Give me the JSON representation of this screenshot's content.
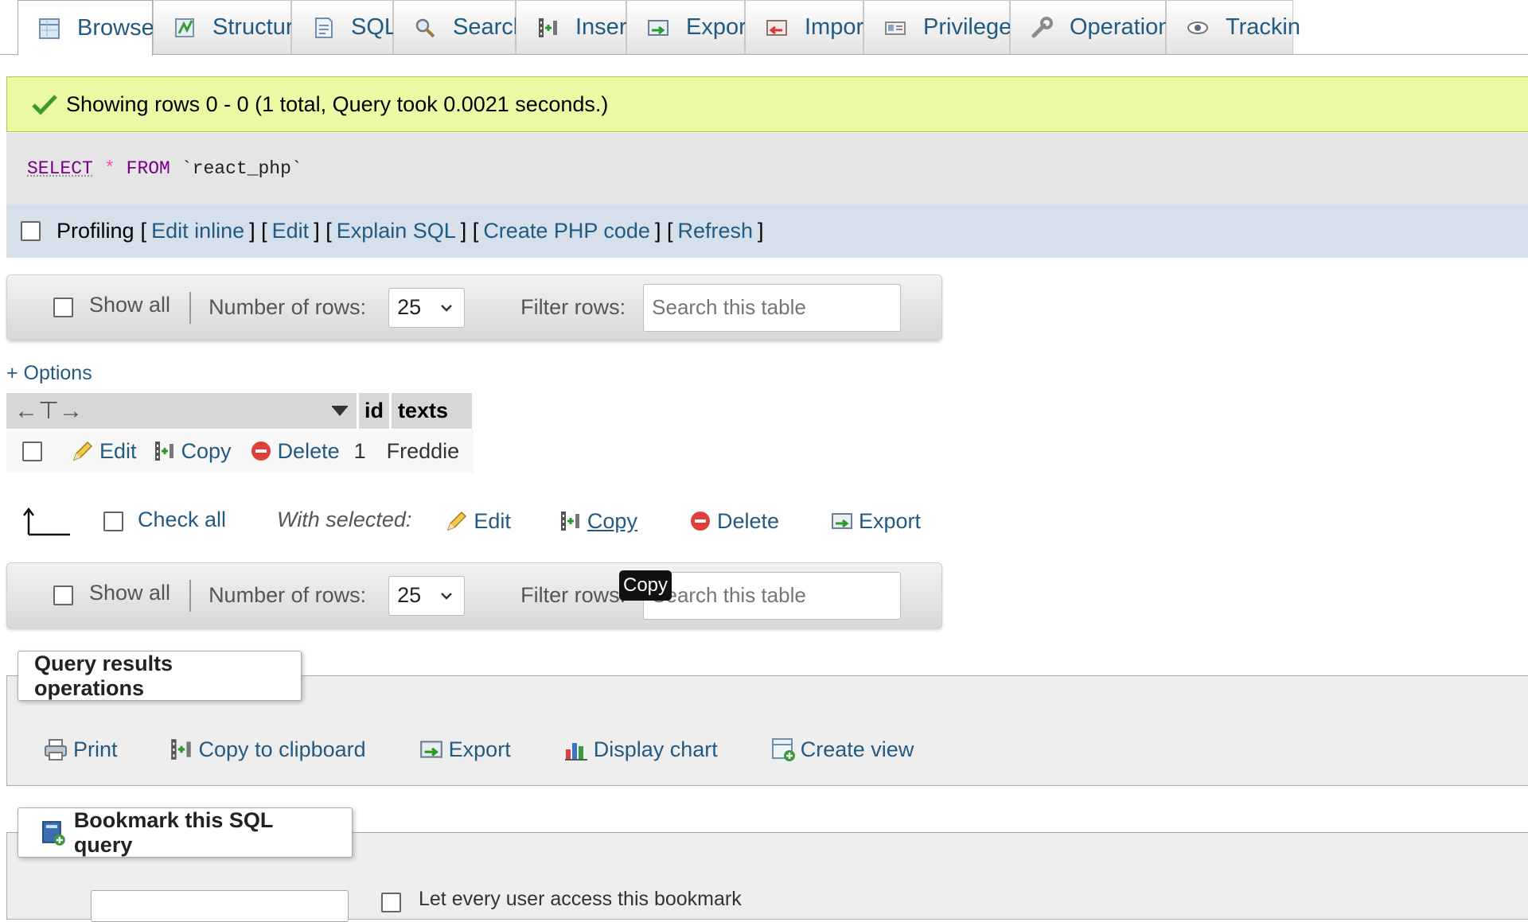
{
  "tabs": [
    {
      "label": "Browse",
      "icon": "browse-icon",
      "active": true
    },
    {
      "label": "Structure",
      "icon": "structure-icon"
    },
    {
      "label": "SQL",
      "icon": "sql-icon"
    },
    {
      "label": "Search",
      "icon": "search-icon"
    },
    {
      "label": "Insert",
      "icon": "insert-icon"
    },
    {
      "label": "Export",
      "icon": "export-icon"
    },
    {
      "label": "Import",
      "icon": "import-icon"
    },
    {
      "label": "Privileges",
      "icon": "privileges-icon"
    },
    {
      "label": "Operations",
      "icon": "wrench-icon"
    },
    {
      "label": "Trackin",
      "icon": "eye-icon"
    }
  ],
  "message": {
    "text": "Showing rows 0 - 0 (1 total, Query took 0.0021 seconds.)",
    "color": "#ebf8a4"
  },
  "sql": {
    "select": "SELECT",
    "star": "*",
    "from": "FROM",
    "table": "`react_php`"
  },
  "profiling": {
    "label": "Profiling",
    "links": [
      "Edit inline",
      "Edit",
      "Explain SQL",
      "Create PHP code",
      "Refresh"
    ]
  },
  "nav": {
    "show_all": "Show all",
    "rows_label": "Number of rows:",
    "rows_value": "25",
    "filter_label": "Filter rows:",
    "filter_placeholder": "Search this table"
  },
  "options_link": "+ Options",
  "table": {
    "columns": [
      "id",
      "texts"
    ],
    "rows": [
      {
        "id": "1",
        "texts": "Freddie"
      }
    ],
    "row_actions": [
      "Edit",
      "Copy",
      "Delete"
    ]
  },
  "with_selected": {
    "check_all": "Check all",
    "label": "With selected:",
    "actions": [
      "Edit",
      "Copy",
      "Delete",
      "Export"
    ]
  },
  "tooltip": "Copy",
  "query_ops": {
    "title": "Query results operations",
    "items": [
      "Print",
      "Copy to clipboard",
      "Export",
      "Display chart",
      "Create view"
    ]
  },
  "bookmark": {
    "title": "Bookmark this SQL query",
    "share_label": "Let every user access this bookmark"
  },
  "colors": {
    "link": "#235a81",
    "success_bg": "#ebf8a4",
    "profiling_bg": "#d5e0ea",
    "delete": "#e0403a"
  }
}
